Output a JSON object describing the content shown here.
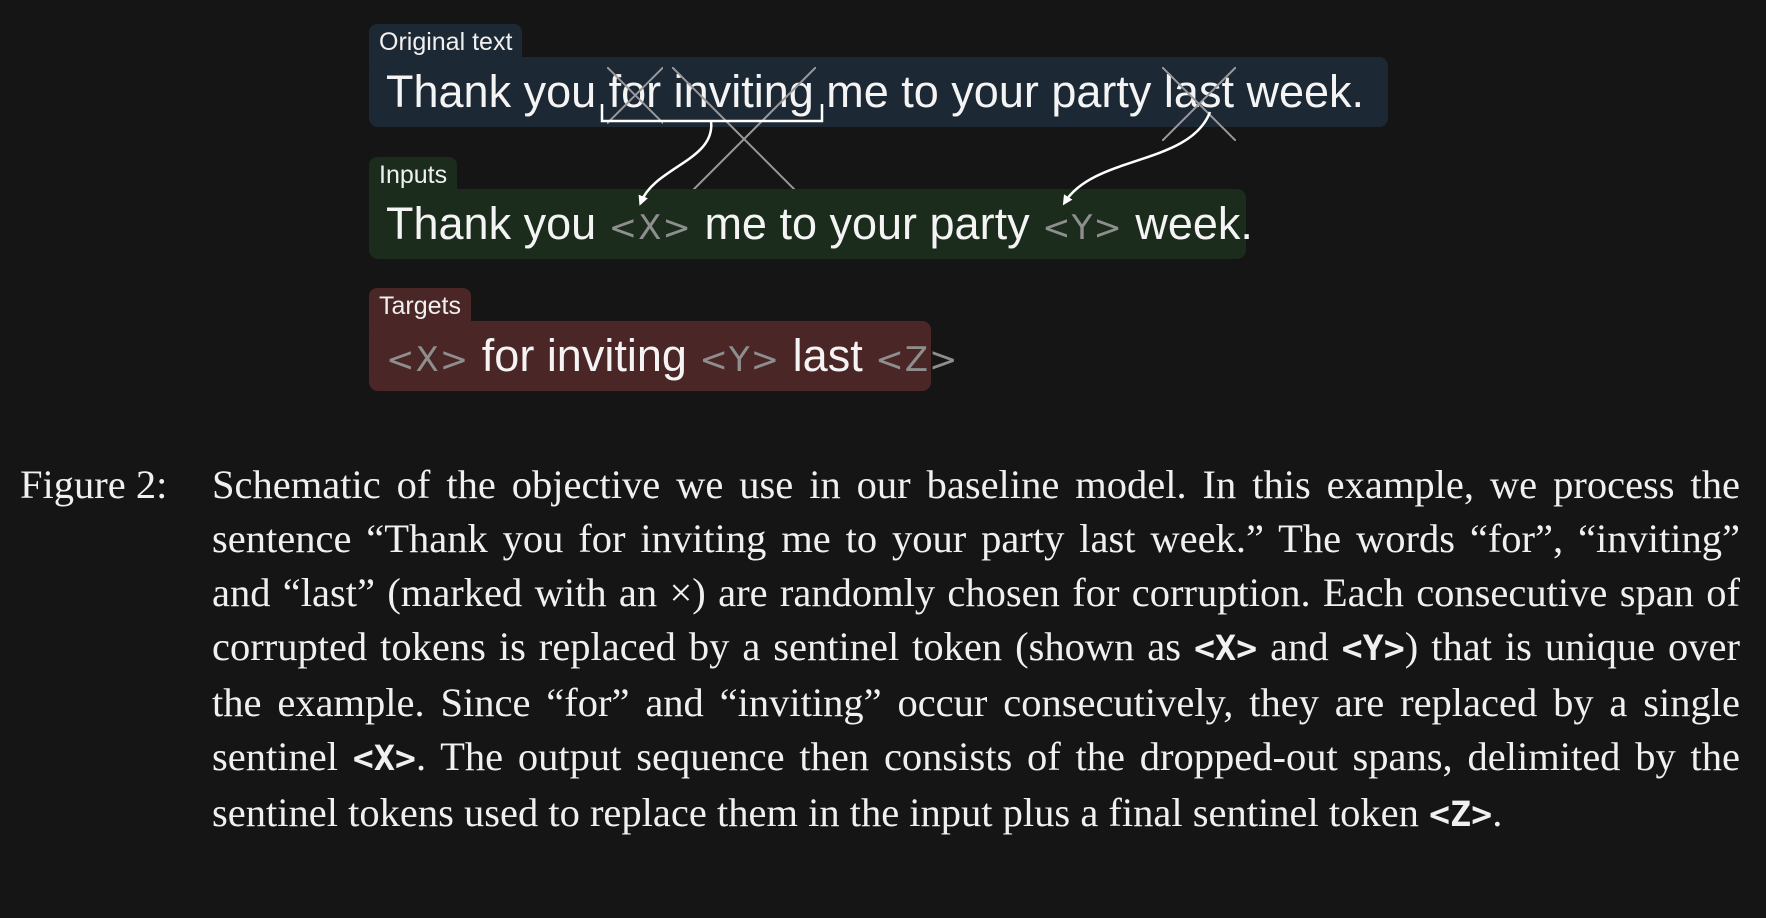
{
  "diagram": {
    "original": {
      "tab": "Original text",
      "words": [
        "Thank you",
        "for",
        "inviting",
        "me to your party",
        "last",
        "week."
      ]
    },
    "inputs": {
      "tab": "Inputs",
      "parts": [
        "Thank you",
        "<X>",
        "me to your party",
        "<Y>",
        "week."
      ]
    },
    "targets": {
      "tab": "Targets",
      "parts": [
        "<X>",
        "for inviting",
        "<Y>",
        "last",
        "<Z>"
      ]
    },
    "colors": {
      "original_box": "#1d2835",
      "inputs_box": "#1c2c1c",
      "targets_box": "#4b2626",
      "sentinel_text": "#8e8e8e",
      "background": "#151515"
    }
  },
  "caption": {
    "label": "Figure 2:",
    "segments": [
      "Schematic of the objective we use in our baseline model. In this example, we process the sentence “Thank you for inviting me to your party last week.” The words “for”, “inviting” and “last” (marked with an ×) are randomly chosen for corruption. Each consecutive span of corrupted tokens is replaced by a sentinel token (shown as ",
      "<X>",
      " and ",
      "<Y>",
      ") that is unique over the example. Since “for” and “inviting” occur consecutively, they are replaced by a single sentinel ",
      "<X>",
      ". The output sequence then consists of the dropped-out spans, delimited by the sentinel tokens used to replace them in the input plus a final sentinel token ",
      "<Z>",
      "."
    ]
  }
}
